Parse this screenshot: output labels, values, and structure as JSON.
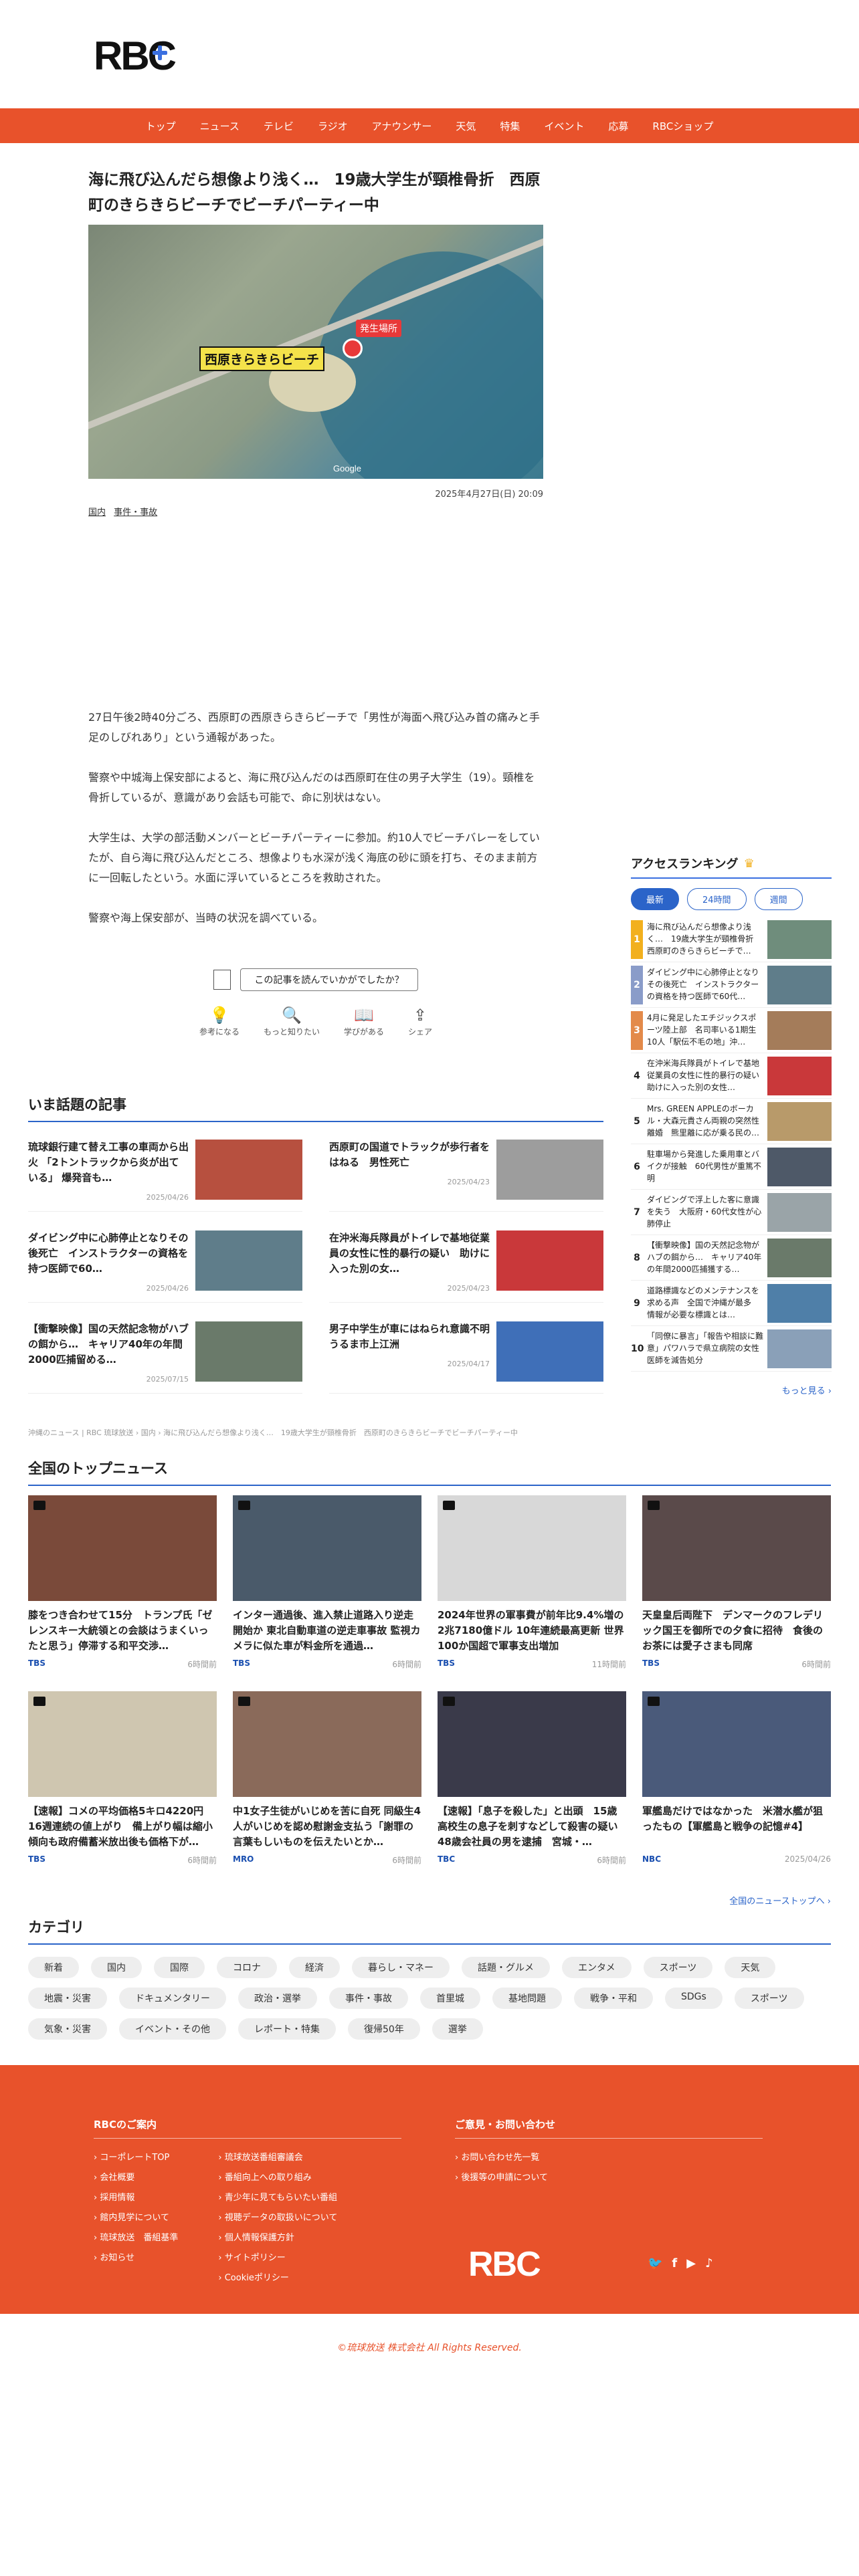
{
  "header": {
    "logo": "RBC"
  },
  "nav": [
    "トップ",
    "ニュース",
    "テレビ",
    "ラジオ",
    "アナウンサー",
    "天気",
    "特集",
    "イベント",
    "応募",
    "RBCショップ"
  ],
  "article": {
    "title": "海に飛び込んだら想像より浅く…　19歳大学生が頸椎骨折　西原町のきらきらビーチでビーチパーティー中",
    "map_label": "西原きらきらビーチ",
    "map_pin": "発生場所",
    "map_credit": "Google",
    "date": "2025年4月27日(日) 20:09",
    "cats": [
      "国内",
      "事件・事故"
    ],
    "body": [
      "27日午後2時40分ごろ、西原町の西原きらきらビーチで「男性が海面へ飛び込み首の痛みと手足のしびれあり」という通報があった。",
      "警察や中城海上保安部によると、海に飛び込んだのは西原町在住の男子大学生（19）。頸椎を骨折しているが、意識があり会話も可能で、命に別状はない。",
      "大学生は、大学の部活動メンバーとビーチパーティーに参加。約10人でビーチバレーをしていたが、自ら海に飛び込んだところ、想像よりも水深が浅く海底の砂に頭を打ち、そのまま前方に一回転したという。水面に浮いているところを救助された。",
      "警察や海上保安部が、当時の状況を調べている。"
    ]
  },
  "reaction": {
    "prompt": "この記事を読んでいかがでしたか？",
    "items": [
      {
        "label": "参考になる"
      },
      {
        "label": "もっと知りたい"
      },
      {
        "label": "学びがある"
      },
      {
        "label": "シェア"
      }
    ]
  },
  "ranking": {
    "title": "アクセスランキング",
    "tabs": [
      "最新",
      "24時間",
      "週間"
    ],
    "items": [
      {
        "n": "1",
        "text": "海に飛び込んだら想像より浅く…　19歳大学生が頸椎骨折　西原町のきらきらビーチで…"
      },
      {
        "n": "2",
        "text": "ダイビング中に心肺停止となりその後死亡　インストラクターの資格を持つ医師で60代…"
      },
      {
        "n": "3",
        "text": "4月に発足したエチジックスポーツ陸上部　名司率いる1期生10人「駅伝不毛の地」沖…"
      },
      {
        "n": "4",
        "text": "在沖米海兵隊員がトイレで基地従業員の女性に性的暴行の疑い　助けに入った別の女性…"
      },
      {
        "n": "5",
        "text": "Mrs. GREEN APPLEのボーカル・大森元貴さん両親の突然性離婚　熊里離に応が乗る民の…"
      },
      {
        "n": "6",
        "text": "駐車場から発進した乗用車とバイクが接触　60代男性が重篤不明"
      },
      {
        "n": "7",
        "text": "ダイビングで浮上した客に意識を失う　大阪府・60代女性が心肺停止"
      },
      {
        "n": "8",
        "text": "【衝撃映像】国の天然記念物がハブの餌から…　キャリア40年の年間2000匹捕獲する…"
      },
      {
        "n": "9",
        "text": "道路標識などのメンテナンスを求める声　全国で沖縄が最多　情報が必要な標識とは…"
      },
      {
        "n": "10",
        "text": "「同僚に暴言」「報告や相談に難意」パワハラで県立病院の女性医師を減告処分"
      }
    ],
    "more": "もっと見る"
  },
  "topic": {
    "title": "いま話題の記事",
    "items": [
      {
        "title": "琉球銀行建て替え工事の車両から出火 「2トントラックから炎が出ている」 爆発音も…",
        "date": "2025/04/26"
      },
      {
        "title": "西原町の国道でトラックが歩行者をはねる　男性死亡",
        "date": "2025/04/23"
      },
      {
        "title": "ダイビング中に心肺停止となりその後死亡　インストラクターの資格を持つ医師で60…",
        "date": "2025/04/26"
      },
      {
        "title": "在沖米海兵隊員がトイレで基地従業員の女性に性的暴行の疑い　助けに入った別の女…",
        "date": "2025/04/23"
      },
      {
        "title": "【衝撃映像】国の天然記念物がハブの餌から…　キャリア40年の年間2000匹捕留める…",
        "date": "2025/07/15"
      },
      {
        "title": "男子中学生が車にはねられ意識不明　うるま市上江洲",
        "date": "2025/04/17"
      }
    ]
  },
  "breadcrumb": "沖縄のニュース | RBC 琉球放送 › 国内 › 海に飛び込んだら想像より浅く…　19歳大学生が頸椎骨折　西原町のきらきらビーチでビーチパーティー中",
  "national": {
    "title": "全国のトップニュース",
    "items": [
      {
        "title": "膝をつき合わせて15分　トランプ氏「ゼレンスキー大統領との会談はうまくいったと思う」停滞する和平交渉…",
        "src": "TBS",
        "time": "6時間前"
      },
      {
        "title": "インター通過後、進入禁止道路入り逆走開始か 東北自動車道の逆走車事故 監視カメラに似た車が料金所を通過…",
        "src": "TBS",
        "time": "6時間前"
      },
      {
        "title": "2024年世界の軍事費が前年比9.4%増の2兆7180億ドル 10年連続最高更新 世界100か国超で軍事支出増加",
        "src": "TBS",
        "time": "11時間前"
      },
      {
        "title": "天皇皇后両陛下　デンマークのフレデリック国王を御所での夕食に招待　食後のお茶には愛子さまも同席",
        "src": "TBS",
        "time": "6時間前"
      },
      {
        "title": "【速報】コメの平均価格5キロ4220円 16週連続の値上がり　備上がり幅は縮小傾向も政府備蓄米放出後も価格下が…",
        "src": "TBS",
        "time": "6時間前"
      },
      {
        "title": "中1女子生徒がいじめを苦に自死 同級生4人がいじめを認め慰謝金支払う「謝罪の言葉もしいものを伝えたいとか…",
        "src": "MRO",
        "time": "6時間前"
      },
      {
        "title": "【速報】「息子を殺した」と出頭　15歳高校生の息子を刺すなどして殺害の疑い48歳会社員の男を逮捕　宮城・…",
        "src": "TBC",
        "time": "6時間前"
      },
      {
        "title": "軍艦島だけではなかった　米潜水艦が狙ったもの【軍艦島と戦争の記憶#4】",
        "src": "NBC",
        "time": "2025/04/26"
      }
    ],
    "more": "全国のニューストップへ"
  },
  "categories": {
    "title": "カテゴリ",
    "chips": [
      "新着",
      "国内",
      "国際",
      "コロナ",
      "経済",
      "暮らし・マネー",
      "話題・グルメ",
      "エンタメ",
      "スポーツ",
      "天気",
      "地震・災害",
      "ドキュメンタリー",
      "政治・選挙",
      "事件・事故",
      "首里城",
      "基地問題",
      "戦争・平和",
      "SDGs",
      "スポーツ",
      "気象・災害",
      "イベント・その他",
      "レポート・特集",
      "復帰50年",
      "選挙"
    ]
  },
  "footer": {
    "about_title": "RBCのご案内",
    "about_col1": [
      "コーポレートTOP",
      "会社概要",
      "採用情報",
      "館内見学について",
      "琉球放送　番組基準",
      "お知らせ"
    ],
    "about_col2": [
      "琉球放送番組審議会",
      "番組向上への取り組み",
      "青少年に見てもらいたい番組",
      "視聴データの取扱いについて",
      "個人情報保護方針",
      "サイトポリシー",
      "Cookieポリシー"
    ],
    "contact_title": "ご意見・お問い合わせ",
    "contact_items": [
      "お問い合わせ先一覧",
      "後援等の申請について"
    ],
    "logo": "RBC",
    "social": [
      "twitter-icon",
      "facebook-icon",
      "youtube-icon",
      "tiktok-icon"
    ],
    "copyright": "©琉球放送 株式会社 All Rights Reserved."
  },
  "colors": {
    "brand": "#e8522b",
    "accent": "#2b64c9"
  }
}
